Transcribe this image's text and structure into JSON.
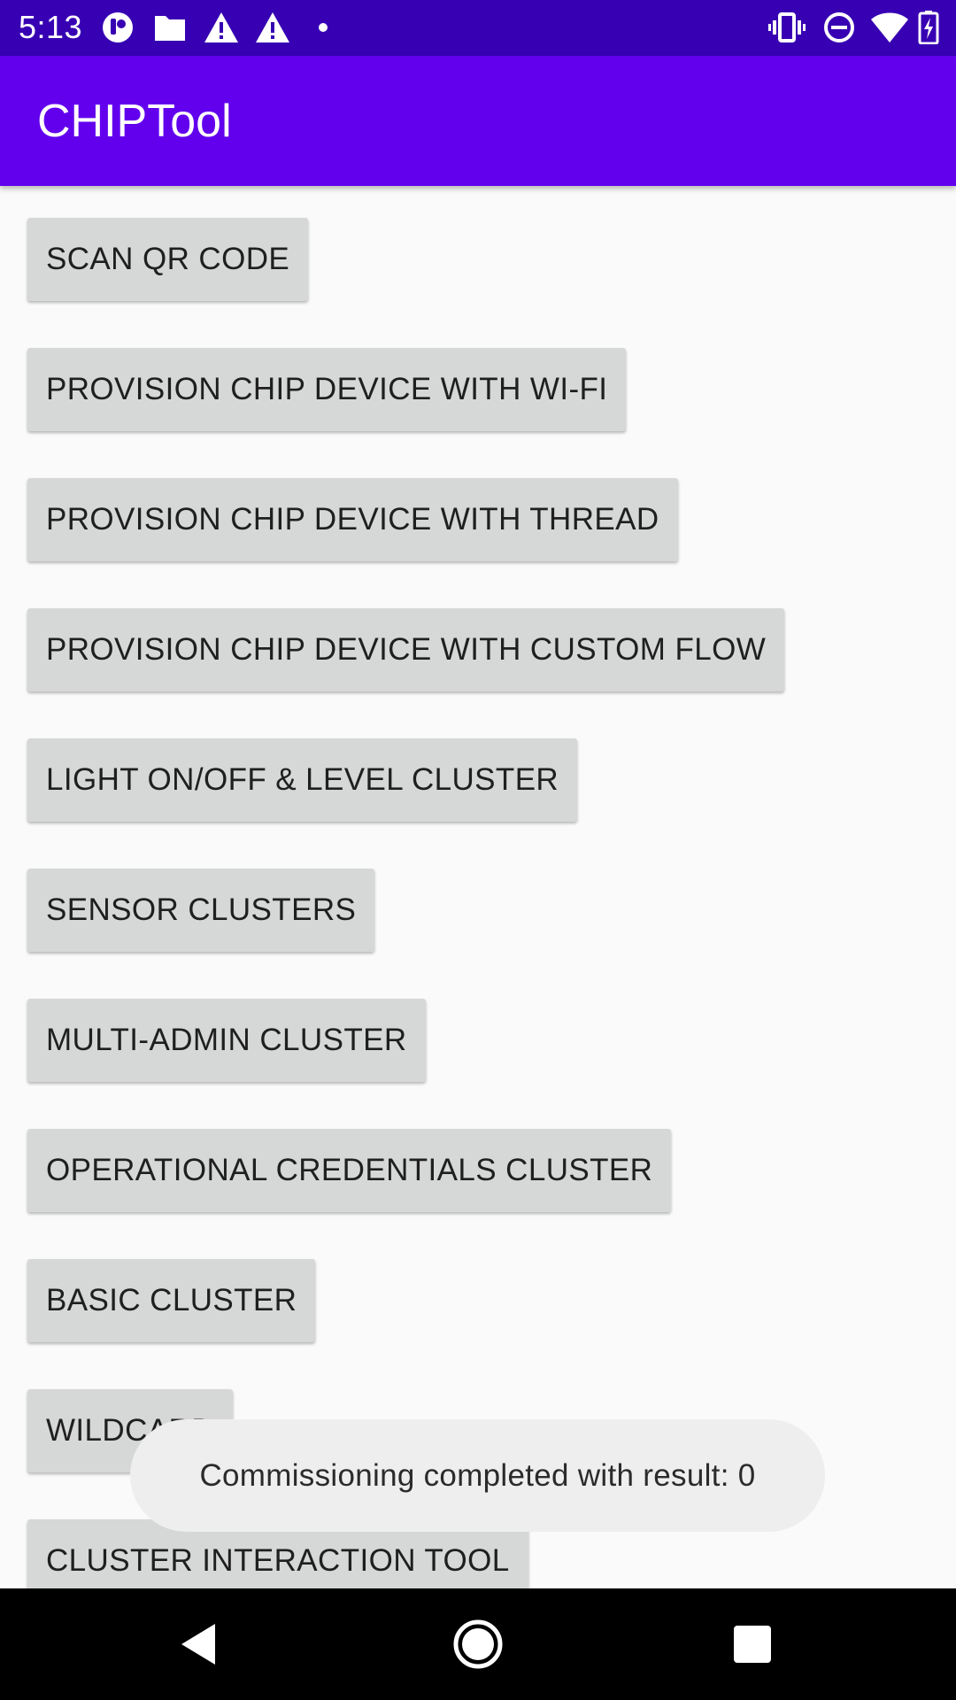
{
  "status_bar": {
    "time": "5:13",
    "left_icons": [
      "assistant-icon",
      "folder-icon",
      "warning-icon",
      "warning-icon",
      "dot-icon"
    ],
    "right_icons": [
      "vibrate-icon",
      "do-not-disturb-icon",
      "wifi-icon",
      "battery-charging-icon"
    ]
  },
  "app_bar": {
    "title": "CHIPTool"
  },
  "buttons": [
    {
      "label": "SCAN QR CODE"
    },
    {
      "label": "PROVISION CHIP DEVICE WITH WI-FI"
    },
    {
      "label": "PROVISION CHIP DEVICE WITH THREAD"
    },
    {
      "label": "PROVISION CHIP DEVICE WITH CUSTOM FLOW"
    },
    {
      "label": "LIGHT ON/OFF & LEVEL CLUSTER"
    },
    {
      "label": "SENSOR CLUSTERS"
    },
    {
      "label": "MULTI-ADMIN CLUSTER"
    },
    {
      "label": "OPERATIONAL CREDENTIALS CLUSTER"
    },
    {
      "label": "BASIC CLUSTER"
    },
    {
      "label": "WILDCARD"
    },
    {
      "label": "CLUSTER INTERACTION TOOL"
    }
  ],
  "toast": {
    "message": "Commissioning completed with result: 0"
  },
  "nav_bar": {
    "icons": [
      "back-icon",
      "home-icon",
      "recents-icon"
    ]
  },
  "colors": {
    "status_bar": "#3700b3",
    "app_bar": "#6200ee",
    "button_bg": "#d6d7d7",
    "background": "#fafafa",
    "toast_bg": "#eeeeee",
    "nav_bar": "#000000"
  }
}
